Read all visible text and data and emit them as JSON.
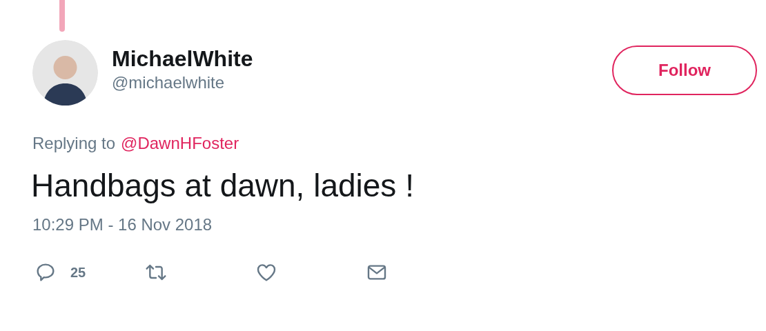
{
  "author": {
    "name": "MichaelWhite",
    "handle": "@michaelwhite"
  },
  "follow_button": {
    "label": "Follow"
  },
  "reply_context": {
    "prefix": "Replying to",
    "mention": "@DawnHFoster"
  },
  "tweet": {
    "text": "Handbags at dawn, ladies !",
    "timestamp": "10:29 PM - 16 Nov 2018"
  },
  "actions": [
    {
      "kind": "reply",
      "count": "25"
    },
    {
      "kind": "retweet"
    },
    {
      "kind": "like"
    },
    {
      "kind": "message"
    }
  ]
}
